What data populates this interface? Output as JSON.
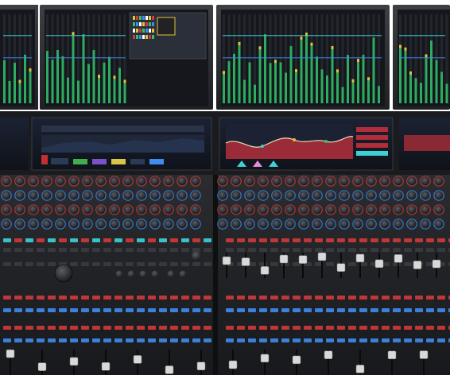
{
  "scene": {
    "subject": "mixing-console",
    "background": "#ffffff",
    "colors": {
      "chassis_dark": "#1c1d20",
      "panel_mid": "#3a3c40",
      "screen_bg": "#141720",
      "meter_green": "#2fc46b",
      "meter_yellow": "#e2c23a",
      "accent_red": "#d23a3a",
      "accent_blue": "#3e8cf0",
      "accent_cyan": "#3fd0d6",
      "eq_red": "#b22d3a",
      "eq_curve": "#e9e2b0",
      "knob_top": "#2b2d31",
      "fader_cap": "#d9d9d9"
    }
  }
}
